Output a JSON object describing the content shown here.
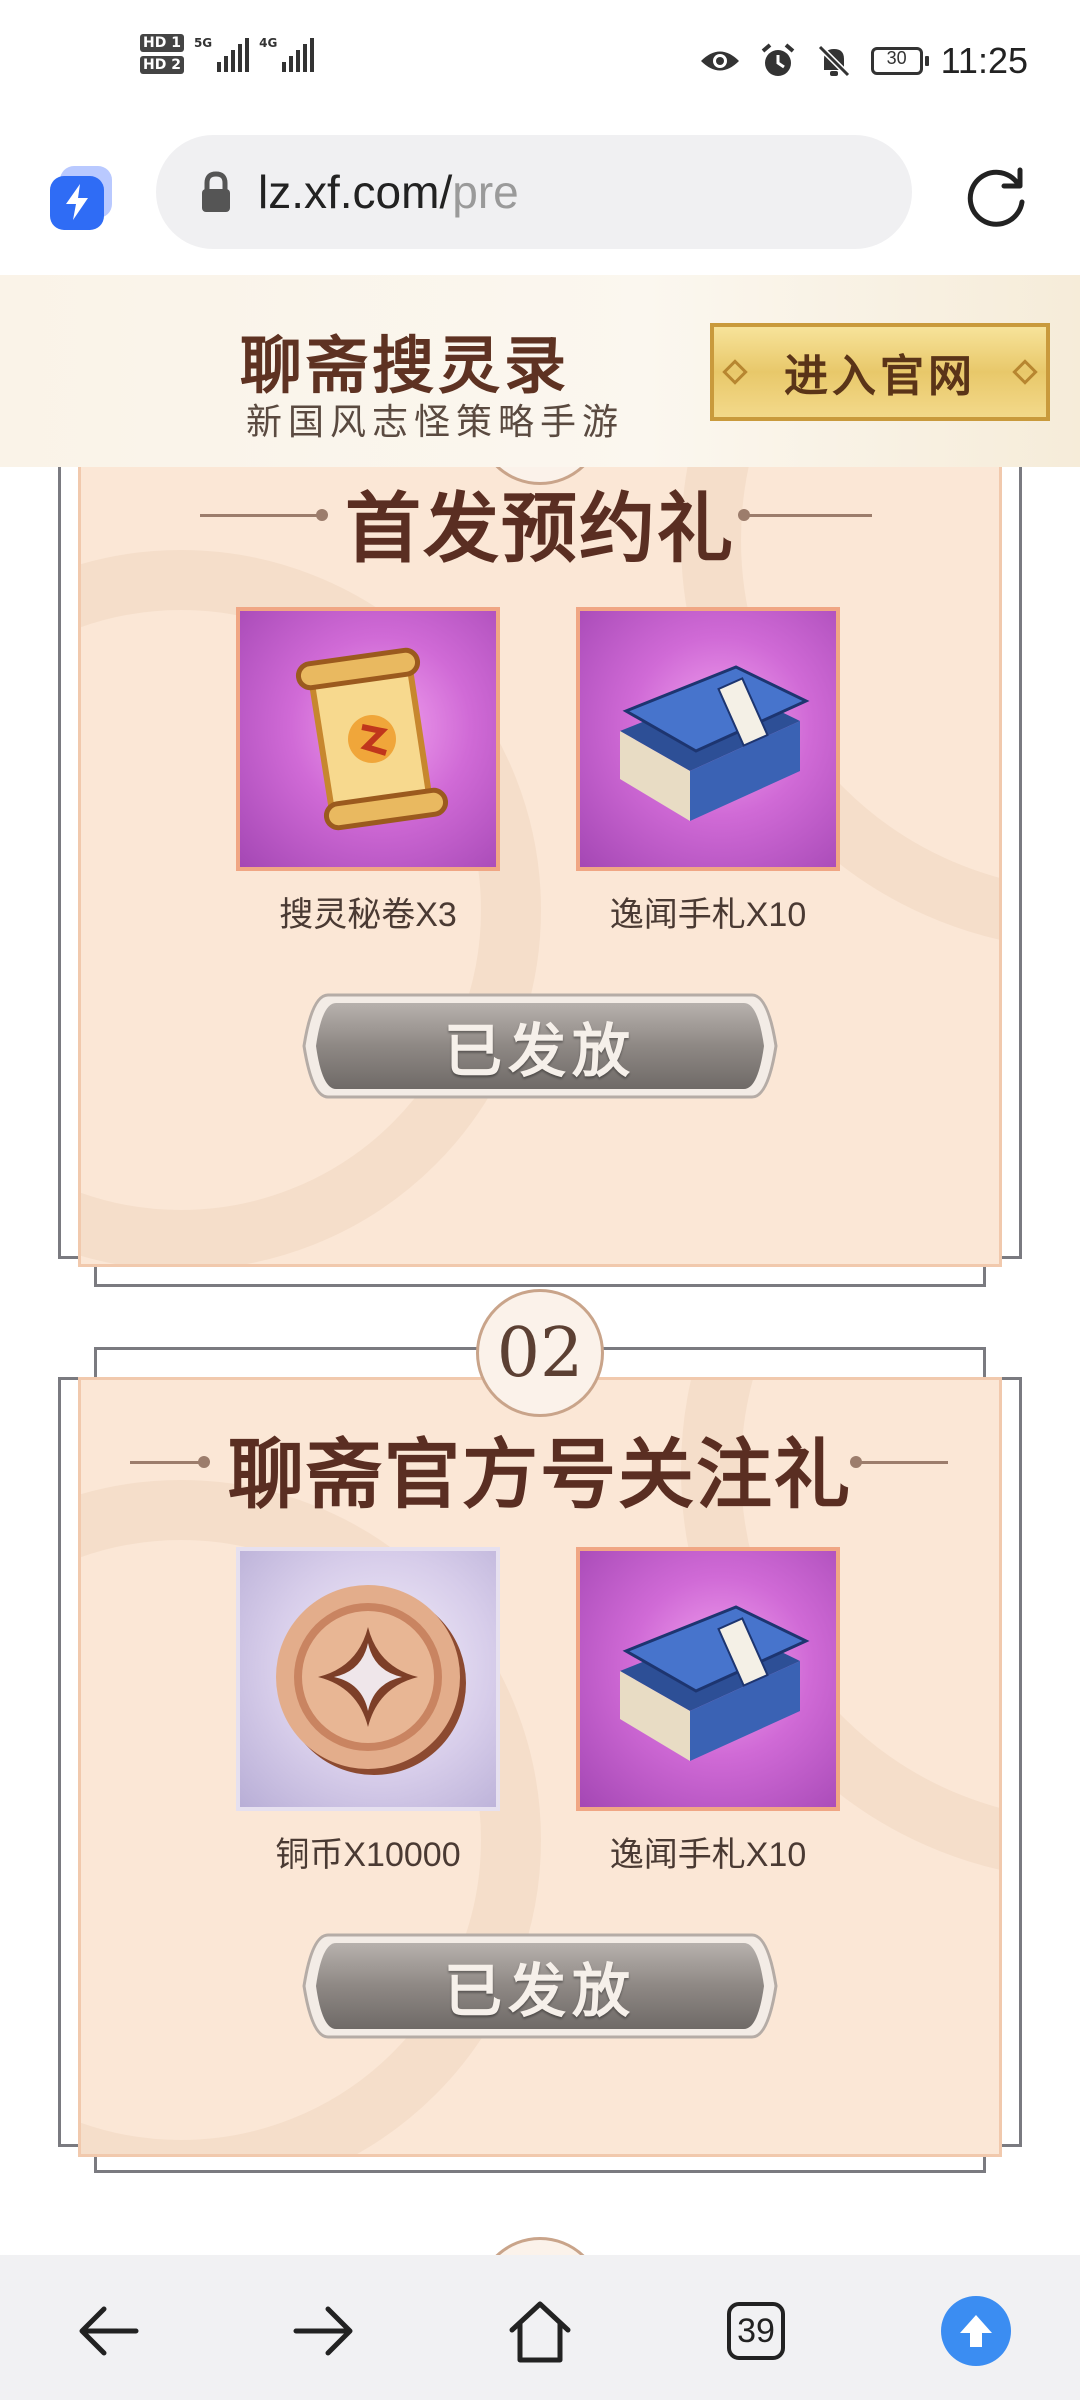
{
  "status_bar": {
    "sim1": "HD 1",
    "sim2": "HD 2",
    "net1": "5G",
    "net2": "4G",
    "battery": "30",
    "time": "11:25",
    "icons": [
      "eye-icon",
      "alarm-icon",
      "bell-muted-icon"
    ]
  },
  "browser": {
    "url_host": "lz.xf.com/",
    "url_path": "pre",
    "tab_count": "39"
  },
  "banner": {
    "title": "聊斋搜灵录",
    "subtitle": "新国风志怪策略手游",
    "cta": "进入官网"
  },
  "gifts": [
    {
      "number": "",
      "title": "首发预约礼",
      "items": [
        {
          "label": "搜灵秘卷X3",
          "icon": "scroll-icon"
        },
        {
          "label": "逸闻手札X10",
          "icon": "book-icon"
        }
      ],
      "status": "已发放"
    },
    {
      "number": "02",
      "title": "聊斋官方号关注礼",
      "items": [
        {
          "label": "铜币X10000",
          "icon": "coin-icon"
        },
        {
          "label": "逸闻手札X10",
          "icon": "book-icon"
        }
      ],
      "status": "已发放"
    }
  ],
  "colors": {
    "card_bg": "#fbe7d6",
    "title_text": "#5a2e22",
    "button_gray": "#8a8582",
    "accent_blue": "#3b8df2"
  }
}
